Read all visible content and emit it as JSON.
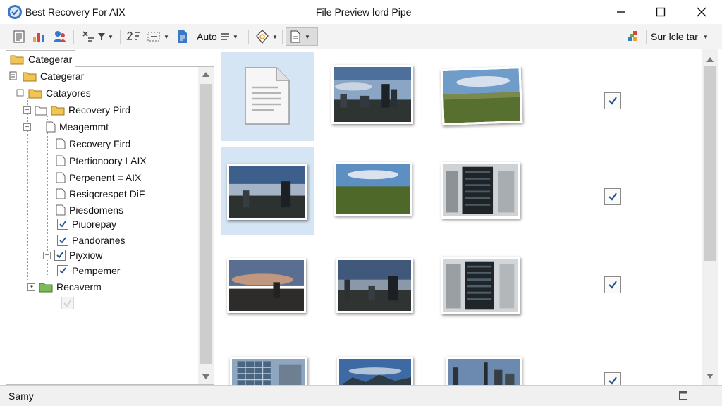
{
  "app": {
    "title": "Best Recovery For AIX",
    "window_title": "File Preview lord Pipe"
  },
  "toolbar": {
    "auto_label": "Auto",
    "search_label": "Sur lcle tar"
  },
  "sidebar": {
    "tab_label": "Categerar",
    "tree": [
      {
        "label": "Categerar"
      },
      {
        "label": "Catayores"
      },
      {
        "label": "Recovery Pird"
      },
      {
        "label": "Meagemmt"
      },
      {
        "label": "Recovery Fird"
      },
      {
        "label": "Ptertionoory LAIX"
      },
      {
        "label": "Perpenent ≡ AIX"
      },
      {
        "label": "Resiqcrespet DiF"
      },
      {
        "label": "Piesdomens"
      },
      {
        "label": "Piuorepay",
        "checked": true
      },
      {
        "label": "Pandoranes",
        "checked": true
      },
      {
        "label": "Piyxiow",
        "checked": true
      },
      {
        "label": "Pempemer",
        "checked": true
      },
      {
        "label": "Recaverm"
      }
    ]
  },
  "status": {
    "text": "Samy"
  }
}
